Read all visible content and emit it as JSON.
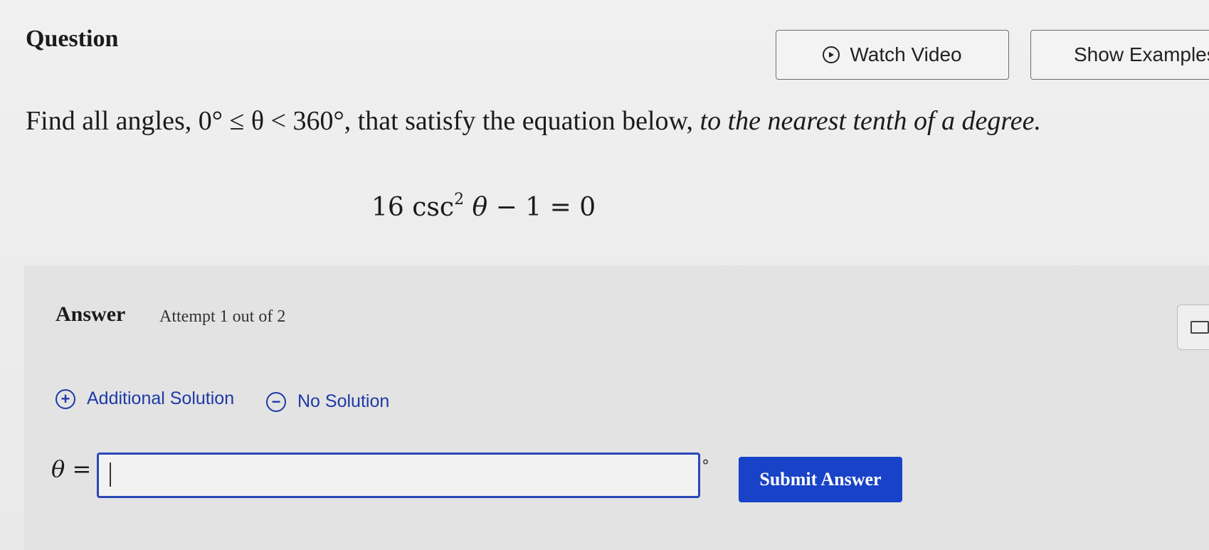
{
  "question": {
    "title": "Question",
    "watch_video_label": "Watch Video",
    "show_examples_label": "Show Examples",
    "prompt_before": "Find all angles, ",
    "prompt_math": "0° ≤ θ < 360°",
    "prompt_middle": ", that satisfy the equation below, ",
    "prompt_emph": "to the nearest tenth of a degree.",
    "equation_coef": "16 csc",
    "equation_exp": "2",
    "equation_var": "θ",
    "equation_rest": " − 1 = 0"
  },
  "answer": {
    "title": "Answer",
    "attempt": "Attempt 1 out of 2",
    "additional_solution_label": "Additional Solution",
    "no_solution_label": "No Solution",
    "var_label": "θ",
    "equals": " =",
    "input_value": "",
    "degree_symbol": "°",
    "submit_label": "Submit Answer"
  },
  "colors": {
    "accent": "#1842c8",
    "link": "#1e3aa6"
  },
  "icons": {
    "video": "play-circle-icon",
    "add": "plus-circle-icon",
    "none": "minus-circle-icon",
    "keyboard": "keyboard-icon"
  }
}
